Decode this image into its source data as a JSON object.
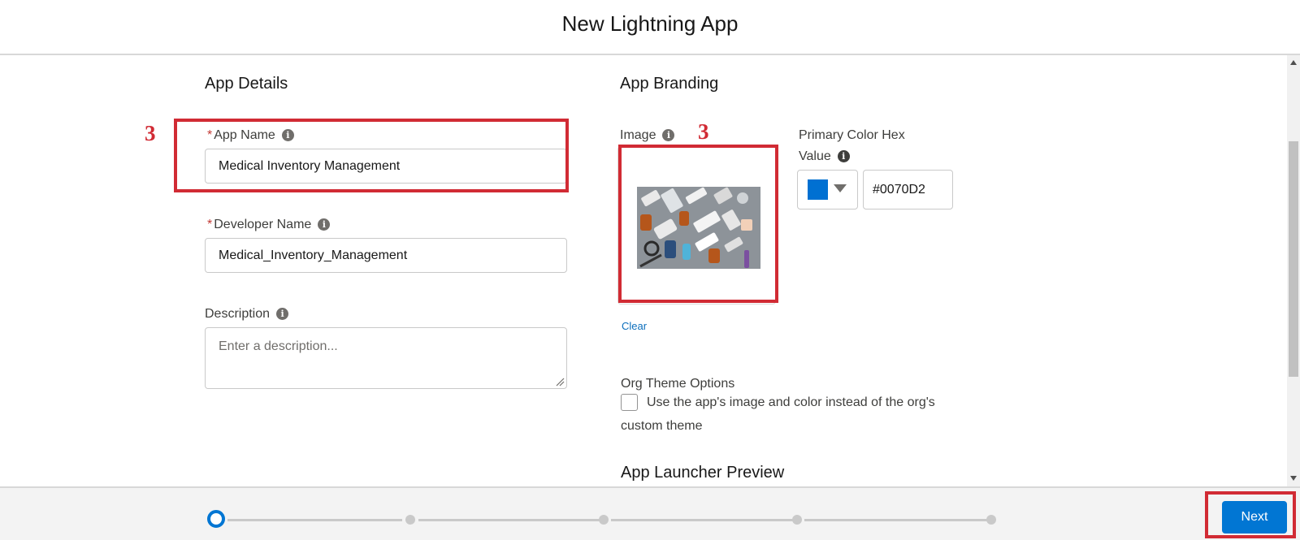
{
  "header": {
    "title": "New Lightning App"
  },
  "app_details": {
    "section_title": "App Details",
    "app_name": {
      "required_mark": "*",
      "label": "App Name",
      "value": "Medical Inventory Management"
    },
    "developer_name": {
      "required_mark": "*",
      "label": "Developer Name",
      "value": "Medical_Inventory_Management"
    },
    "description": {
      "label": "Description",
      "placeholder": "Enter a description..."
    }
  },
  "app_branding": {
    "section_title": "App Branding",
    "image_label": "Image",
    "clear_link": "Clear",
    "primary_color_label_line1": "Primary Color Hex",
    "primary_color_label_line2": "Value",
    "primary_color_value": "#0070D2",
    "swatch_color": "#0070D2",
    "org_theme_title": "Org Theme Options",
    "org_theme_checkbox_label": "Use the app's image and color instead of the org's custom theme",
    "org_theme_checked": false,
    "launcher_preview_title": "App Launcher Preview"
  },
  "annotations": {
    "app_name_step": "3",
    "image_step": "3",
    "annotation_color": "#d12b34"
  },
  "footer": {
    "next_label": "Next",
    "current_step": 1,
    "total_steps": 5
  },
  "icons": {
    "info": "info-icon",
    "caret": "chevron-down-icon"
  },
  "accent_color": "#0176d3"
}
